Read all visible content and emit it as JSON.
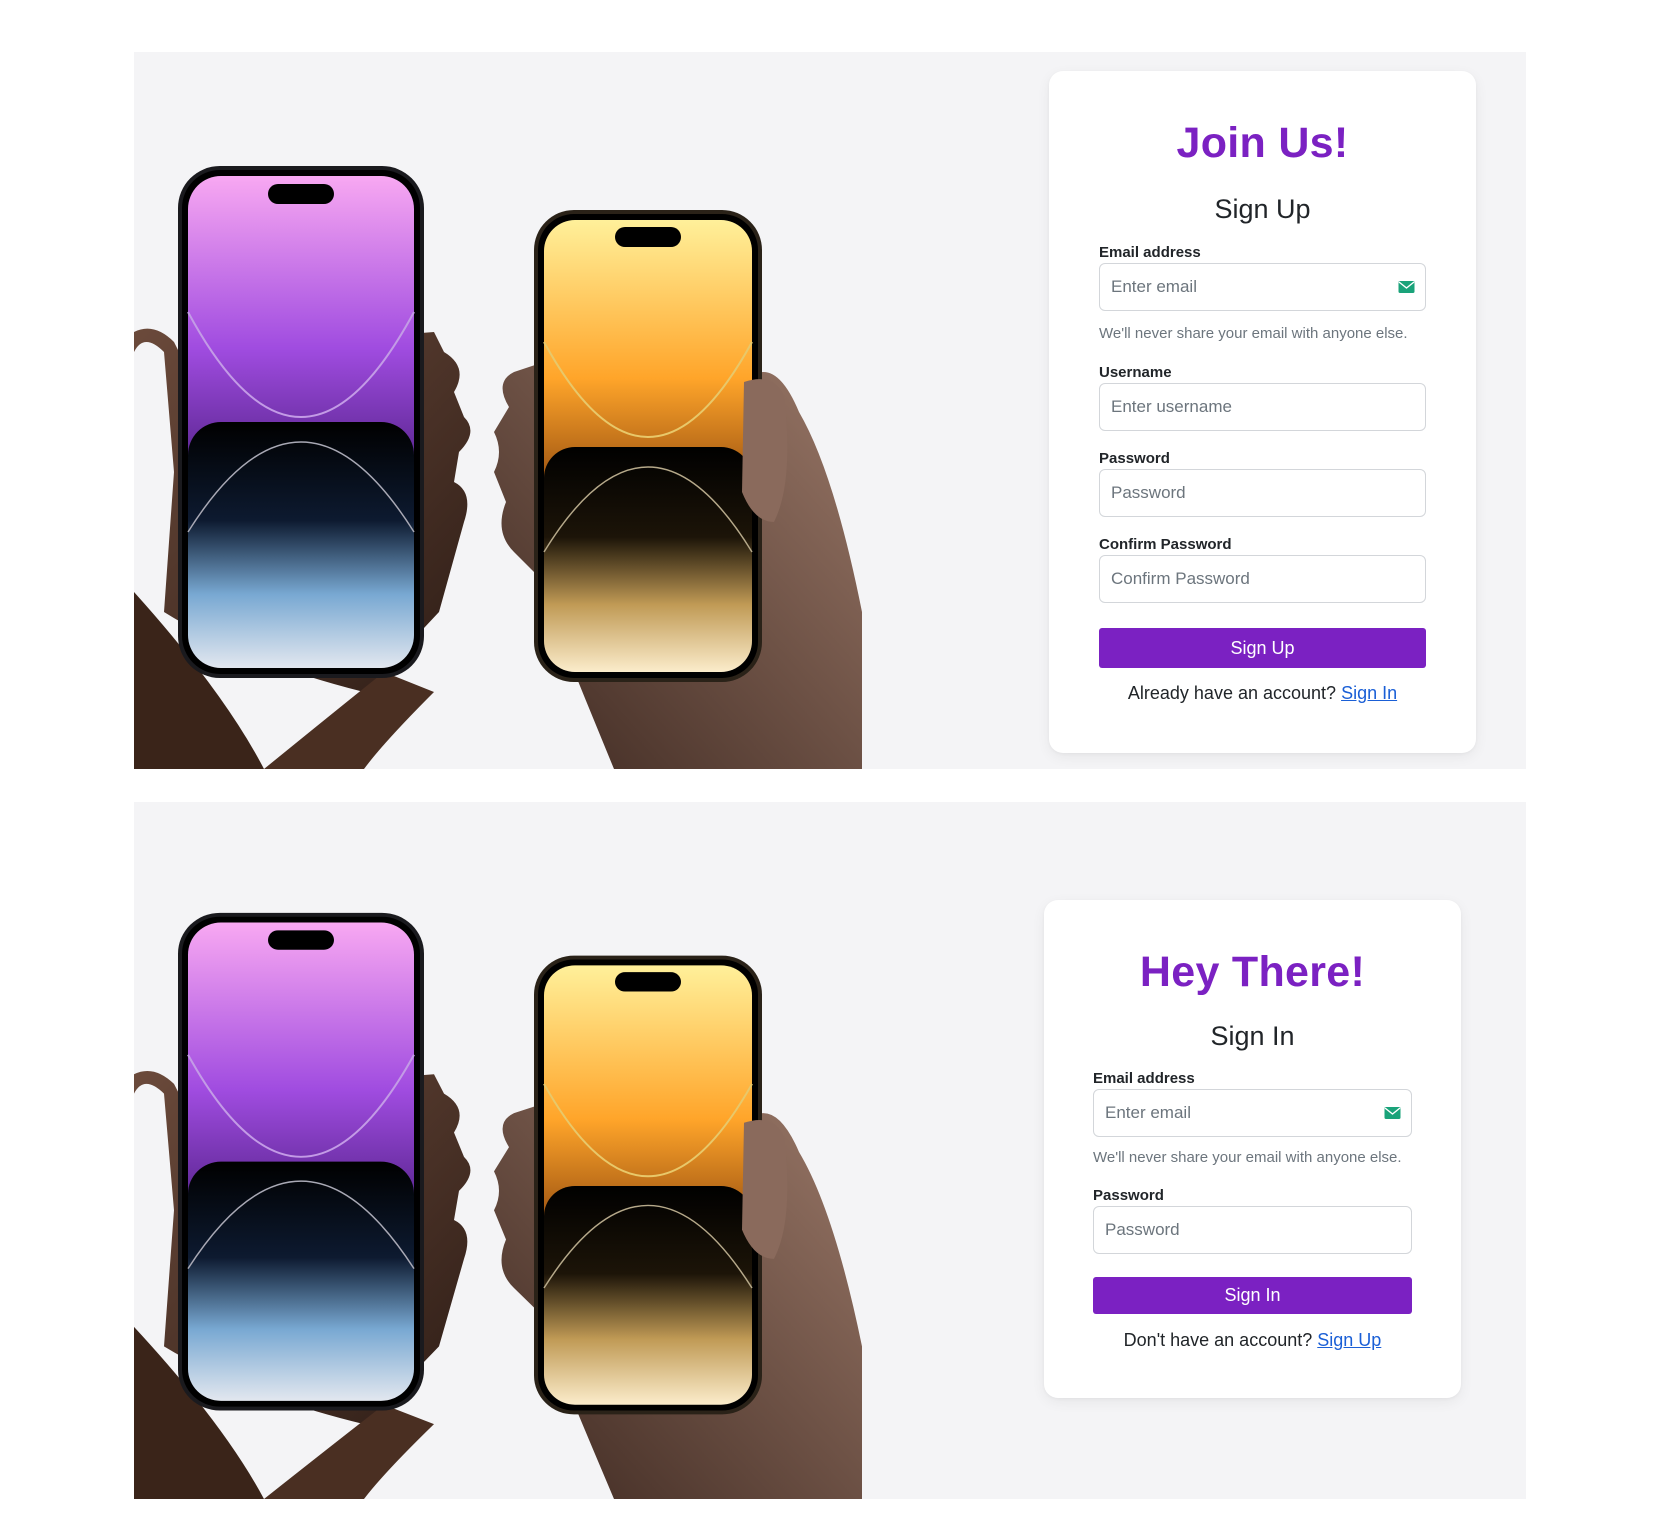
{
  "signup": {
    "title": "Join Us!",
    "subtitle": "Sign Up",
    "email_label": "Email address",
    "email_placeholder": "Enter email",
    "email_help": "We'll never share your email with anyone else.",
    "username_label": "Username",
    "username_placeholder": "Enter username",
    "password_label": "Password",
    "password_placeholder": "Password",
    "confirm_label": "Confirm Password",
    "confirm_placeholder": "Confirm Password",
    "submit_label": "Sign Up",
    "switch_text": "Already have an account?",
    "switch_link": "Sign In"
  },
  "signin": {
    "title": "Hey There!",
    "subtitle": "Sign In",
    "email_label": "Email address",
    "email_placeholder": "Enter email",
    "email_help": "We'll never share your email with anyone else.",
    "password_label": "Password",
    "password_placeholder": "Password",
    "submit_label": "Sign In",
    "switch_text": "Don't have an account?",
    "switch_link": "Sign Up"
  },
  "colors": {
    "accent": "#7b21c2",
    "link": "#1a5fd6",
    "panel_bg": "#f4f4f6",
    "mail_icon": "#1aa37a"
  },
  "icons": {
    "email_field_icon": "envelope-icon",
    "hero_image": "phones-in-hands-illustration"
  }
}
